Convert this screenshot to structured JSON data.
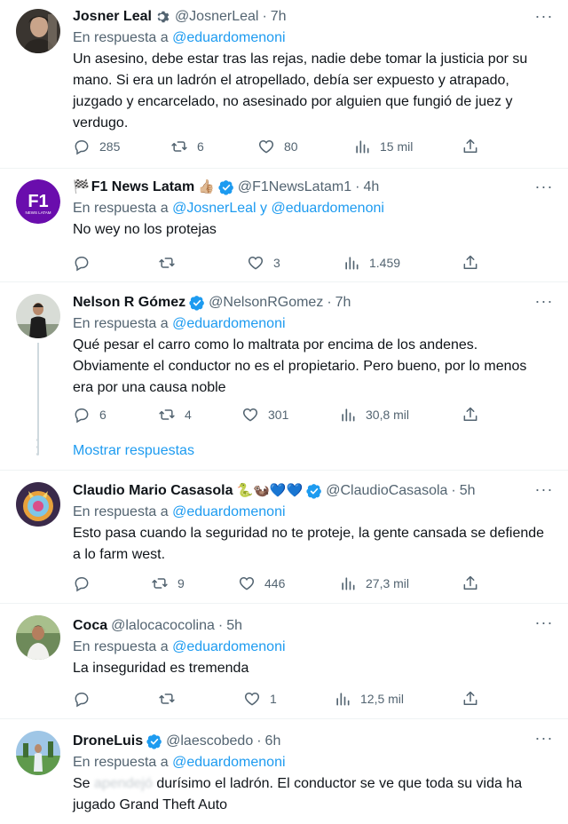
{
  "tweets": [
    {
      "name": "Josner Leal",
      "name_suffix_icon": "gear-icon",
      "handle": "@JosnerLeal",
      "time": "7h",
      "reply_prefix": "En respuesta a ",
      "reply_to": "@eduardomenoni",
      "text": "Un asesino, debe estar tras las rejas, nadie debe tomar la justicia por su mano. Si era un ladrón el atropellado, debía ser expuesto y atrapado, juzgado y encarcelado, no asesinado por alguien que fungió de juez y verdugo.",
      "replies": "285",
      "retweets": "6",
      "likes": "80",
      "views": "15 mil"
    },
    {
      "name": "F1 News Latam",
      "name_prefix_emoji": "🏁",
      "name_suffix_emoji": "👍🏼",
      "verified": true,
      "handle": "@F1NewsLatam1",
      "time": "4h",
      "reply_prefix": "En respuesta a ",
      "reply_to": "@JosnerLeal y @eduardomenoni",
      "text": "No wey no los protejas",
      "replies": "",
      "retweets": "",
      "likes": "3",
      "views": "1.459",
      "avatar_text": "F1",
      "avatar_subtext": "NEWS LATAM"
    },
    {
      "name": "Nelson R Gómez",
      "verified": true,
      "handle": "@NelsonRGomez",
      "time": "7h",
      "reply_prefix": "En respuesta a ",
      "reply_to": "@eduardomenoni",
      "text": "Qué pesar el carro como lo maltrata por encima de los andenes. Obviamente el conductor no es el propietario. Pero bueno, por lo menos era por una causa noble",
      "replies": "6",
      "retweets": "4",
      "likes": "301",
      "views": "30,8 mil",
      "show_replies": "Mostrar respuestas"
    },
    {
      "name": "Claudio Mario Casasola",
      "name_suffix_emoji": "🐍🦦💙💙",
      "verified": true,
      "handle": "@ClaudioCasasola",
      "time": "5h",
      "reply_prefix": "En respuesta a ",
      "reply_to": "@eduardomenoni",
      "text": "Esto pasa cuando la seguridad no te proteje, la gente cansada se defiende a lo farm west.",
      "replies": "",
      "retweets": "9",
      "likes": "446",
      "views": "27,3 mil"
    },
    {
      "name": "Coca",
      "handle": "@lalocacocolina",
      "time": "5h",
      "reply_prefix": "En respuesta a ",
      "reply_to": "@eduardomenoni",
      "text": "La inseguridad es tremenda",
      "replies": "",
      "retweets": "",
      "likes": "1",
      "views": "12,5 mil"
    },
    {
      "name": "DroneLuis",
      "verified": true,
      "handle": "@laescobedo",
      "time": "6h",
      "reply_prefix": "En respuesta a ",
      "reply_to": "@eduardomenoni",
      "text_before": "Se",
      "text_blurred": "apendejó",
      "text_after": "durísimo el ladrón. El conductor se ve que toda su vida ha jugado Grand Theft Auto"
    }
  ],
  "colors": {
    "accent": "#1d9bf0",
    "secondary_text": "#536471",
    "primary_text": "#0f1419",
    "divider": "#eff3f4"
  },
  "time_separator": "·"
}
